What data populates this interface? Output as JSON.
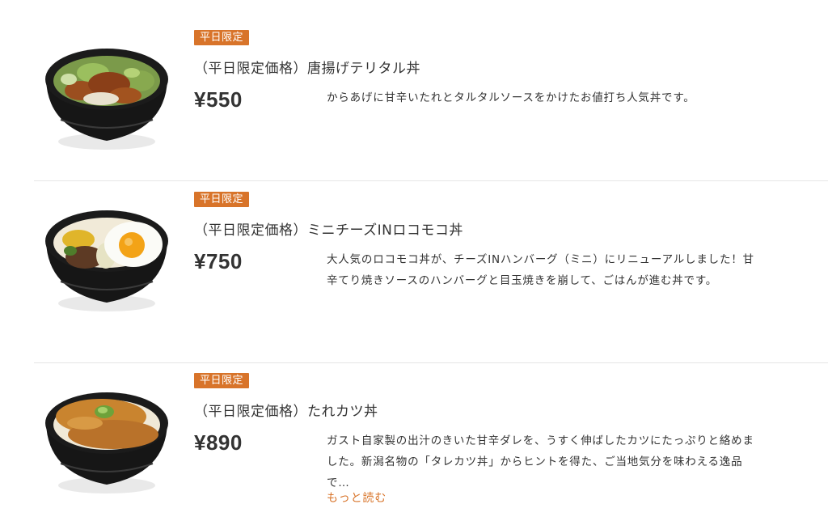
{
  "colors": {
    "badge_bg": "#d8742a",
    "text": "#333333",
    "link": "#d8742a",
    "divider": "#e6e6e6"
  },
  "menu": {
    "items": [
      {
        "image": "karaage-tartar-donburi-photo",
        "badge": "平日限定",
        "title": "（平日限定価格）唐揚げテリタル丼",
        "price": "¥550",
        "description": "からあげに甘辛いたれとタルタルソースをかけたお値打ち人気丼です。"
      },
      {
        "image": "loco-moco-donburi-photo",
        "badge": "平日限定",
        "title": "（平日限定価格）ミニチーズINロコモコ丼",
        "price": "¥750",
        "description": "大人気のロコモコ丼が、チーズINハンバーグ（ミニ）にリニューアルしました！甘辛てり焼きソースのハンバーグと目玉焼きを崩して、ごはんが進む丼です。"
      },
      {
        "image": "tare-katsu-donburi-photo",
        "badge": "平日限定",
        "title": "（平日限定価格）たれカツ丼",
        "price": "¥890",
        "description": "ガスト自家製の出汁のきいた甘辛ダレを、うすく伸ばしたカツにたっぷりと絡めました。新潟名物の「タレカツ丼」からヒントを得た、ご当地気分を味わえる逸品で…",
        "read_more": "もっと読む"
      }
    ]
  }
}
